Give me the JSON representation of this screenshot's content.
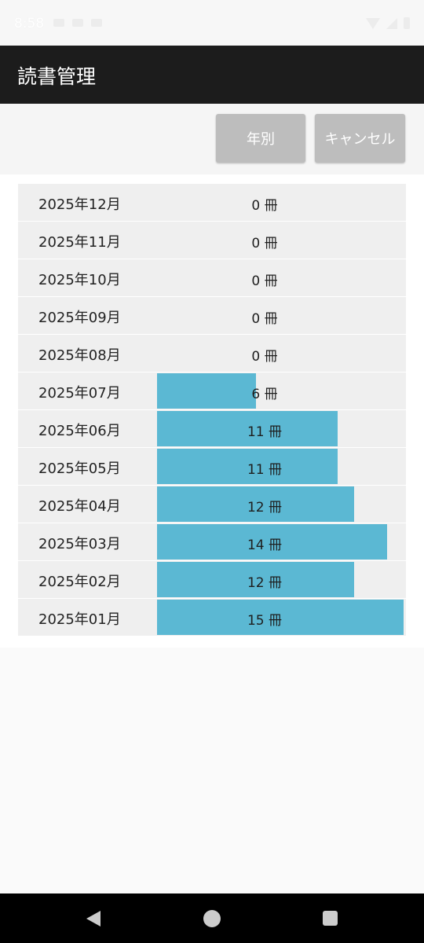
{
  "status_bar": {
    "time": "8:58",
    "icons": [
      "wifi-icon",
      "signal-icon",
      "battery-icon"
    ]
  },
  "app_bar": {
    "title": "読書管理"
  },
  "toolbar": {
    "year_button_label": "年別",
    "cancel_button_label": "キャンセル"
  },
  "chart_data": {
    "type": "bar",
    "orientation": "horizontal",
    "unit": "冊",
    "max_value": 15,
    "bar_color": "#5bb8d3",
    "rows": [
      {
        "month": "2025年12月",
        "value": 0,
        "label": "0 冊"
      },
      {
        "month": "2025年11月",
        "value": 0,
        "label": "0 冊"
      },
      {
        "month": "2025年10月",
        "value": 0,
        "label": "0 冊"
      },
      {
        "month": "2025年09月",
        "value": 0,
        "label": "0 冊"
      },
      {
        "month": "2025年08月",
        "value": 0,
        "label": "0 冊"
      },
      {
        "month": "2025年07月",
        "value": 6,
        "label": "6 冊"
      },
      {
        "month": "2025年06月",
        "value": 11,
        "label": "11 冊"
      },
      {
        "month": "2025年05月",
        "value": 11,
        "label": "11 冊"
      },
      {
        "month": "2025年04月",
        "value": 12,
        "label": "12 冊"
      },
      {
        "month": "2025年03月",
        "value": 14,
        "label": "14 冊"
      },
      {
        "month": "2025年02月",
        "value": 12,
        "label": "12 冊"
      },
      {
        "month": "2025年01月",
        "value": 15,
        "label": "15 冊"
      }
    ]
  },
  "nav_bar": {
    "icons": [
      "back-icon",
      "home-icon",
      "recents-icon"
    ]
  }
}
